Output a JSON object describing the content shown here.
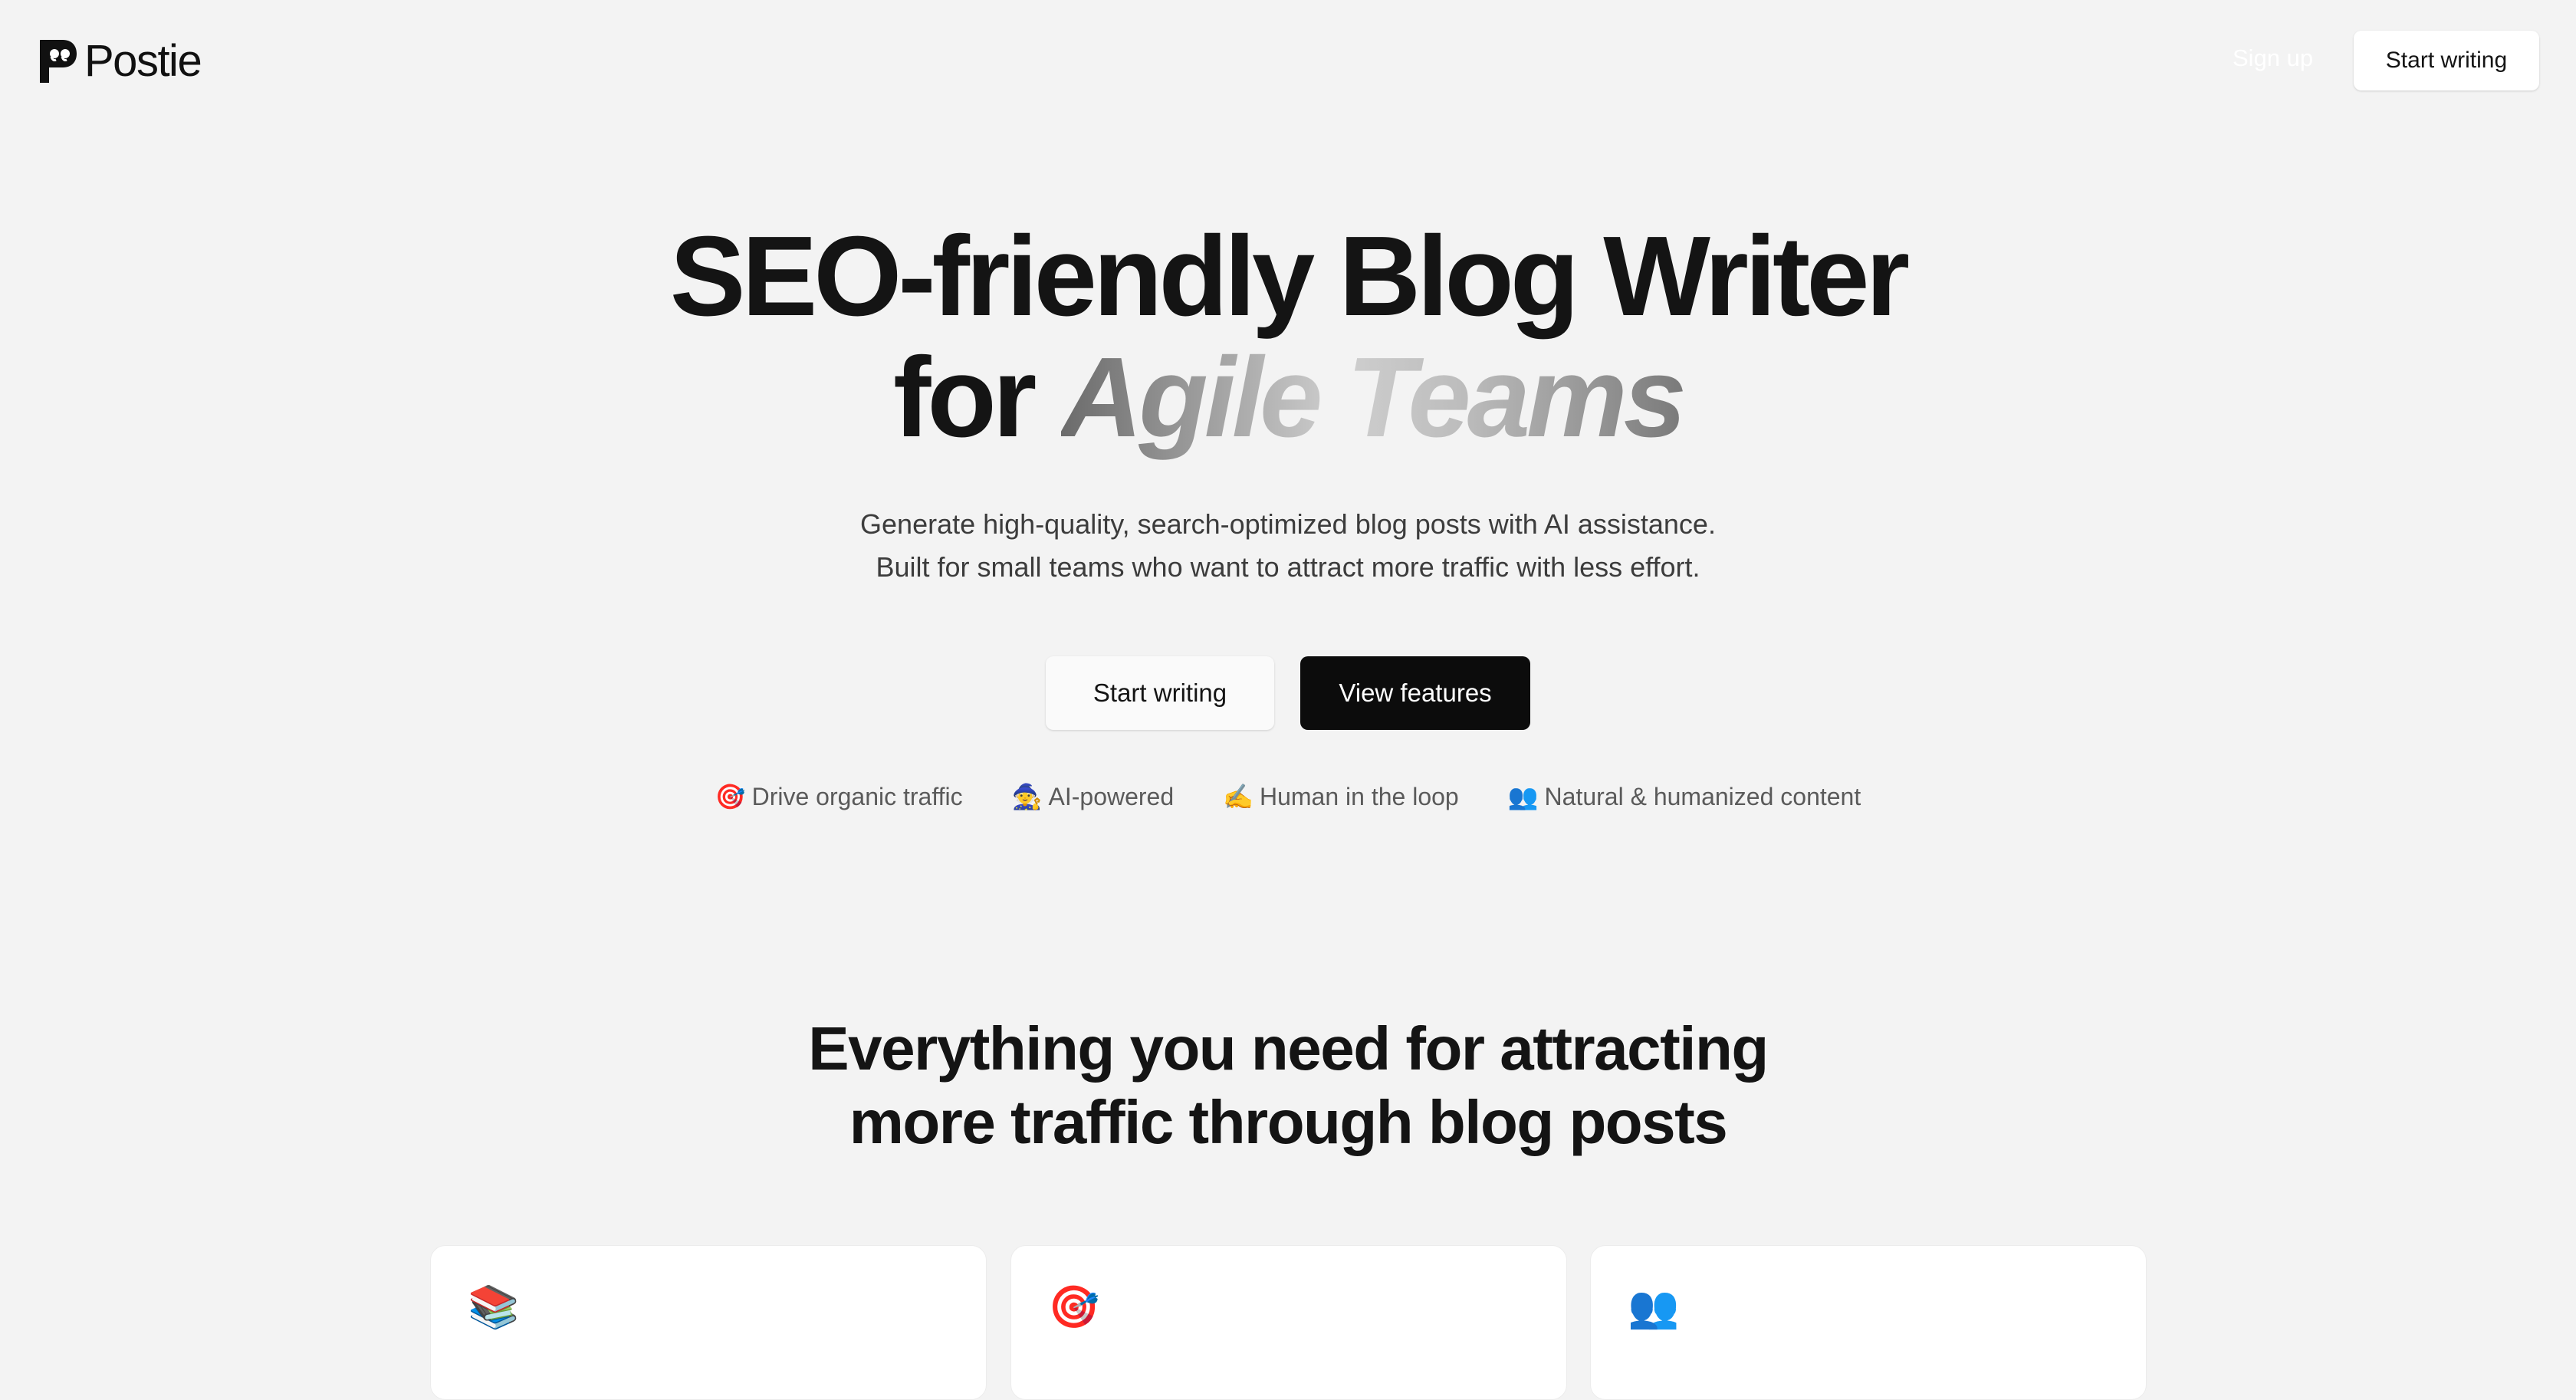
{
  "nav": {
    "brand": "Postie",
    "signup_label": "Sign up",
    "start_label": "Start writing"
  },
  "hero": {
    "title_line1": "SEO-friendly Blog Writer",
    "title_prefix": "for ",
    "title_accent": "Agile Teams",
    "subtitle_line1": "Generate high-quality, search-optimized blog posts with AI assistance.",
    "subtitle_line2": "Built for small teams who want to attract more traffic with less effort.",
    "primary_cta": "Start writing",
    "secondary_cta": "View features"
  },
  "features": [
    {
      "emoji": "🎯",
      "label": "Drive organic traffic"
    },
    {
      "emoji": "🧙",
      "label": "AI-powered"
    },
    {
      "emoji": "✍️",
      "label": "Human in the loop"
    },
    {
      "emoji": "👥",
      "label": "Natural & humanized content"
    }
  ],
  "section": {
    "title_line1": "Everything you need for attracting",
    "title_line2": "more traffic through blog posts"
  },
  "cards": [
    {
      "icon": "📚",
      "icon_name": "books-icon"
    },
    {
      "icon": "🎯",
      "icon_name": "target-icon"
    },
    {
      "icon": "👥",
      "icon_name": "people-icon"
    }
  ],
  "colors": {
    "background": "#f3f3f3",
    "text": "#141414",
    "dark_button": "#0c0c0c",
    "muted_text": "#5a5a5a"
  }
}
